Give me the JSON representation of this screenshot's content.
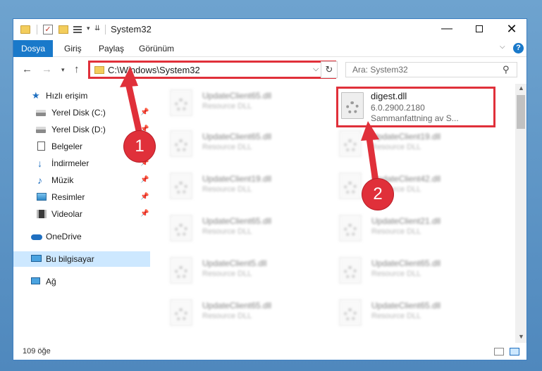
{
  "window": {
    "title": "System32",
    "controls": {
      "minimize": "—",
      "maximize": "",
      "close": "✕"
    }
  },
  "ribbon": {
    "file_tab": "Dosya",
    "tabs": [
      "Giriş",
      "Paylaş",
      "Görünüm"
    ],
    "help": "?"
  },
  "address": {
    "path": "C:\\Windows\\System32",
    "search_placeholder": "Ara: System32"
  },
  "sidebar": {
    "quick_access": "Hızlı erişim",
    "items": [
      {
        "label": "Yerel Disk (C:)",
        "pinned": true
      },
      {
        "label": "Yerel Disk (D:)",
        "pinned": true
      },
      {
        "label": "Belgeler",
        "pinned": true
      },
      {
        "label": "İndirmeler",
        "pinned": true
      },
      {
        "label": "Müzik",
        "pinned": true
      },
      {
        "label": "Resimler",
        "pinned": true
      },
      {
        "label": "Videolar",
        "pinned": true
      }
    ],
    "onedrive": "OneDrive",
    "this_pc": "Bu bilgisayar",
    "network": "Ağ",
    "pin_glyph": "📌"
  },
  "files": {
    "left_column": [
      {
        "name": "UpdateClient65.dll",
        "type": "Resource DLL"
      },
      {
        "name": "UpdateClient65.dll",
        "type": "Resource DLL"
      },
      {
        "name": "UpdateClient19.dll",
        "type": "Resource DLL"
      },
      {
        "name": "UpdateClient65.dll",
        "type": "Resource DLL"
      },
      {
        "name": "UpdateClient5.dll",
        "type": "Resource DLL"
      },
      {
        "name": "UpdateClient65.dll",
        "type": "Resource DLL"
      }
    ],
    "right_column": [
      {
        "name": "UpdateClient19.dll",
        "type": "Resource DLL"
      },
      {
        "name": "UpdateClient42.dll",
        "type": "Resource DLL"
      },
      {
        "name": "UpdateClient21.dll",
        "type": "Resource DLL"
      },
      {
        "name": "UpdateClient65.dll",
        "type": "Resource DLL"
      },
      {
        "name": "UpdateClient65.dll",
        "type": "Resource DLL"
      }
    ],
    "highlighted": {
      "name": "digest.dll",
      "version": "6.0.2900.2180",
      "description": "Sammanfattning av S..."
    }
  },
  "status": {
    "item_count": "109 öğe"
  },
  "callouts": [
    "1",
    "2"
  ],
  "colors": {
    "accent": "#1979ca",
    "highlight": "#e0303a"
  }
}
